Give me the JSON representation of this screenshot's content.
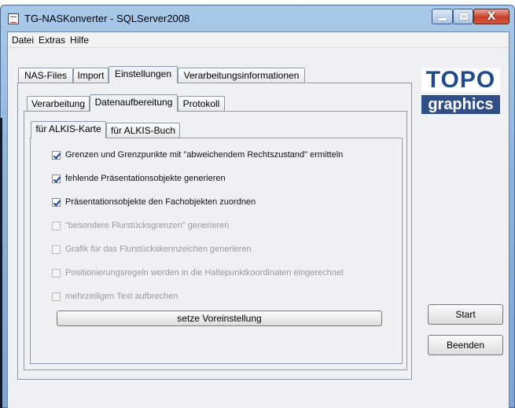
{
  "window": {
    "title": "TG-NASKonverter - SQLServer2008",
    "close_glyph": "X"
  },
  "menubar": {
    "items": [
      "Datei",
      "Extras",
      "Hilfe"
    ]
  },
  "main_tabs": [
    "NAS-Files",
    "Import",
    "Einstellungen",
    "Verarbeitungsinformationen"
  ],
  "main_tabs_active": "Einstellungen",
  "sub_tabs": [
    "Verarbeitung",
    "Datenaufbereitung",
    "Protokoll"
  ],
  "sub_tabs_active": "Datenaufbereitung",
  "inner_tabs": [
    "für ALKIS-Karte",
    "für ALKIS-Buch"
  ],
  "inner_tabs_active": "für ALKIS-Karte",
  "options": [
    {
      "label": "Grenzen und Grenzpunkte mit \"abweichendem Rechtszustand\" ermitteln",
      "checked": true,
      "enabled": true
    },
    {
      "label": "fehlende Präsentationsobjekte generieren",
      "checked": true,
      "enabled": true
    },
    {
      "label": "Präsentationsobjekte den Fachobjekten zuordnen",
      "checked": true,
      "enabled": true
    },
    {
      "label": "\"besondere Flurstücksgrenzen\" generieren",
      "checked": false,
      "enabled": false
    },
    {
      "label": "Grafik für das Flurstückskennzeichen generieren",
      "checked": false,
      "enabled": false
    },
    {
      "label": "Positionierungsregeln werden in die Haltepunktkoordinaten eingerechnet",
      "checked": false,
      "enabled": false
    },
    {
      "label": "mehrzeiligen Text aufbrechen",
      "checked": false,
      "enabled": false
    }
  ],
  "buttons": {
    "defaults": "setze Voreinstellung",
    "start": "Start",
    "end": "Beenden"
  },
  "logo": {
    "top": "TOPO",
    "bottom": "graphics"
  },
  "colors": {
    "logo_blue": "#1f4a8c",
    "logo_band": "#2f4f86",
    "check_color": "#1c3f96"
  }
}
